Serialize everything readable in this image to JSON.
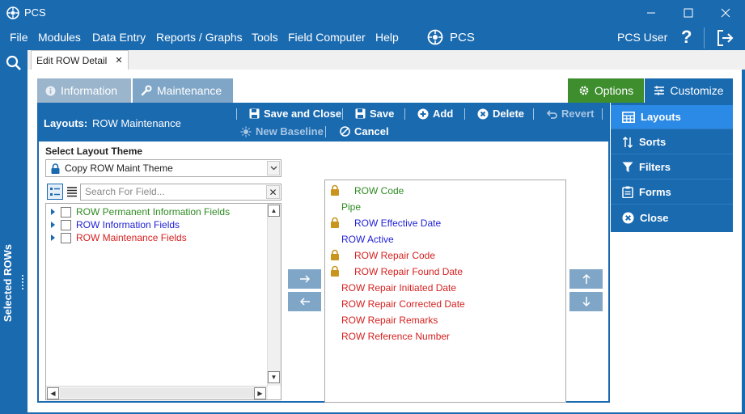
{
  "window": {
    "title": "PCS"
  },
  "menu": [
    "File",
    "Modules",
    "Data Entry",
    "Reports / Graphs",
    "Tools",
    "Field Computer",
    "Help"
  ],
  "brand": "PCS",
  "user": "PCS User",
  "leftrail": {
    "label": "Selected ROWs"
  },
  "doc_tab": {
    "label": "Edit ROW Detail"
  },
  "panel_tabs": {
    "information": "Information",
    "maintenance": "Maintenance"
  },
  "options_label": "Options",
  "customize_label": "Customize",
  "toolbar": {
    "layouts_label": "Layouts:",
    "layouts_value": "ROW Maintenance",
    "save_and_close": "Save and Close",
    "save": "Save",
    "add": "Add",
    "delete": "Delete",
    "revert": "Revert",
    "new_baseline": "New Baseline",
    "cancel": "Cancel"
  },
  "theme": {
    "label": "Select Layout Theme",
    "value": "Copy ROW Maint Theme"
  },
  "search": {
    "placeholder": "Search For Field..."
  },
  "tree": [
    {
      "label": "ROW Permanent Information Fields",
      "color": "#2e8b22"
    },
    {
      "label": "ROW Information Fields",
      "color": "#1f1fd6"
    },
    {
      "label": "ROW Maintenance Fields",
      "color": "#d61f1f"
    }
  ],
  "fields": [
    {
      "label": "ROW Code",
      "color": "#2e8b22",
      "locked": true,
      "indent": true
    },
    {
      "label": "Pipe",
      "color": "#2e8b22",
      "locked": false,
      "indent": false
    },
    {
      "label": "ROW Effective Date",
      "color": "#1f1fd6",
      "locked": true,
      "indent": true
    },
    {
      "label": "ROW Active",
      "color": "#1f1fd6",
      "locked": false,
      "indent": false
    },
    {
      "label": "ROW Repair Code",
      "color": "#d61f1f",
      "locked": true,
      "indent": true
    },
    {
      "label": "ROW Repair Found Date",
      "color": "#d61f1f",
      "locked": true,
      "indent": true
    },
    {
      "label": "ROW Repair Initiated Date",
      "color": "#d61f1f",
      "locked": false,
      "indent": false
    },
    {
      "label": "ROW Repair Corrected Date",
      "color": "#d61f1f",
      "locked": false,
      "indent": false
    },
    {
      "label": "ROW Repair Remarks",
      "color": "#d61f1f",
      "locked": false,
      "indent": false
    },
    {
      "label": "ROW Reference Number",
      "color": "#d61f1f",
      "locked": false,
      "indent": false
    }
  ],
  "side_panel": [
    "Layouts",
    "Sorts",
    "Filters",
    "Forms",
    "Close"
  ]
}
